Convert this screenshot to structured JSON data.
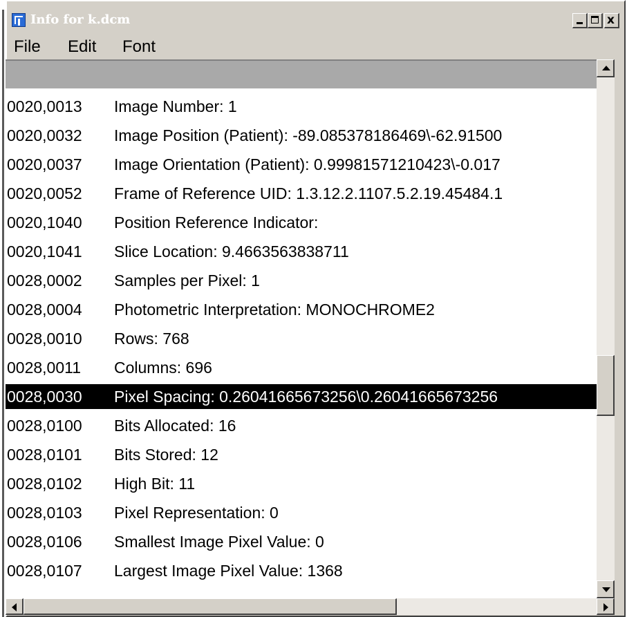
{
  "window": {
    "title": "Info for k.dcm",
    "controls": {
      "minimize": "_",
      "maximize": "□",
      "close": "x"
    }
  },
  "menu": [
    "File",
    "Edit",
    "Font"
  ],
  "colors": {
    "selected_bg": "#000000",
    "selected_text": "#ffffff",
    "header_band": "#a9a9a9"
  },
  "rows": [
    {
      "tag": "0020,0013",
      "desc": "Image Number: 1",
      "selected": false
    },
    {
      "tag": "0020,0032",
      "desc": "Image Position (Patient): -89.085378186469\\-62.91500",
      "selected": false
    },
    {
      "tag": "0020,0037",
      "desc": "Image Orientation (Patient): 0.99981571210423\\-0.017",
      "selected": false
    },
    {
      "tag": "0020,0052",
      "desc": "Frame of Reference UID: 1.3.12.2.1107.5.2.19.45484.1",
      "selected": false
    },
    {
      "tag": "0020,1040",
      "desc": "Position Reference Indicator:",
      "selected": false
    },
    {
      "tag": "0020,1041",
      "desc": "Slice Location: 9.4663563838711",
      "selected": false
    },
    {
      "tag": "0028,0002",
      "desc": "Samples per Pixel: 1",
      "selected": false
    },
    {
      "tag": "0028,0004",
      "desc": "Photometric Interpretation: MONOCHROME2",
      "selected": false
    },
    {
      "tag": "0028,0010",
      "desc": "Rows: 768",
      "selected": false
    },
    {
      "tag": "0028,0011",
      "desc": "Columns: 696",
      "selected": false
    },
    {
      "tag": "0028,0030",
      "desc": "Pixel Spacing: 0.26041665673256\\0.26041665673256",
      "selected": true
    },
    {
      "tag": "0028,0100",
      "desc": "Bits Allocated: 16",
      "selected": false
    },
    {
      "tag": "0028,0101",
      "desc": "Bits Stored: 12",
      "selected": false
    },
    {
      "tag": "0028,0102",
      "desc": "High Bit: 11",
      "selected": false
    },
    {
      "tag": "0028,0103",
      "desc": "Pixel Representation: 0",
      "selected": false
    },
    {
      "tag": "0028,0106",
      "desc": "Smallest Image Pixel Value: 0",
      "selected": false
    },
    {
      "tag": "0028,0107",
      "desc": "Largest Image Pixel Value: 1368",
      "selected": false
    }
  ],
  "icons": {
    "app": "imagej-icon",
    "scroll_up": "arrow-up-icon",
    "scroll_down": "arrow-down-icon",
    "scroll_left": "arrow-left-icon",
    "scroll_right": "arrow-right-icon"
  },
  "scroll": {
    "vertical_fraction": 0.58,
    "horizontal_fraction": 0.0
  }
}
